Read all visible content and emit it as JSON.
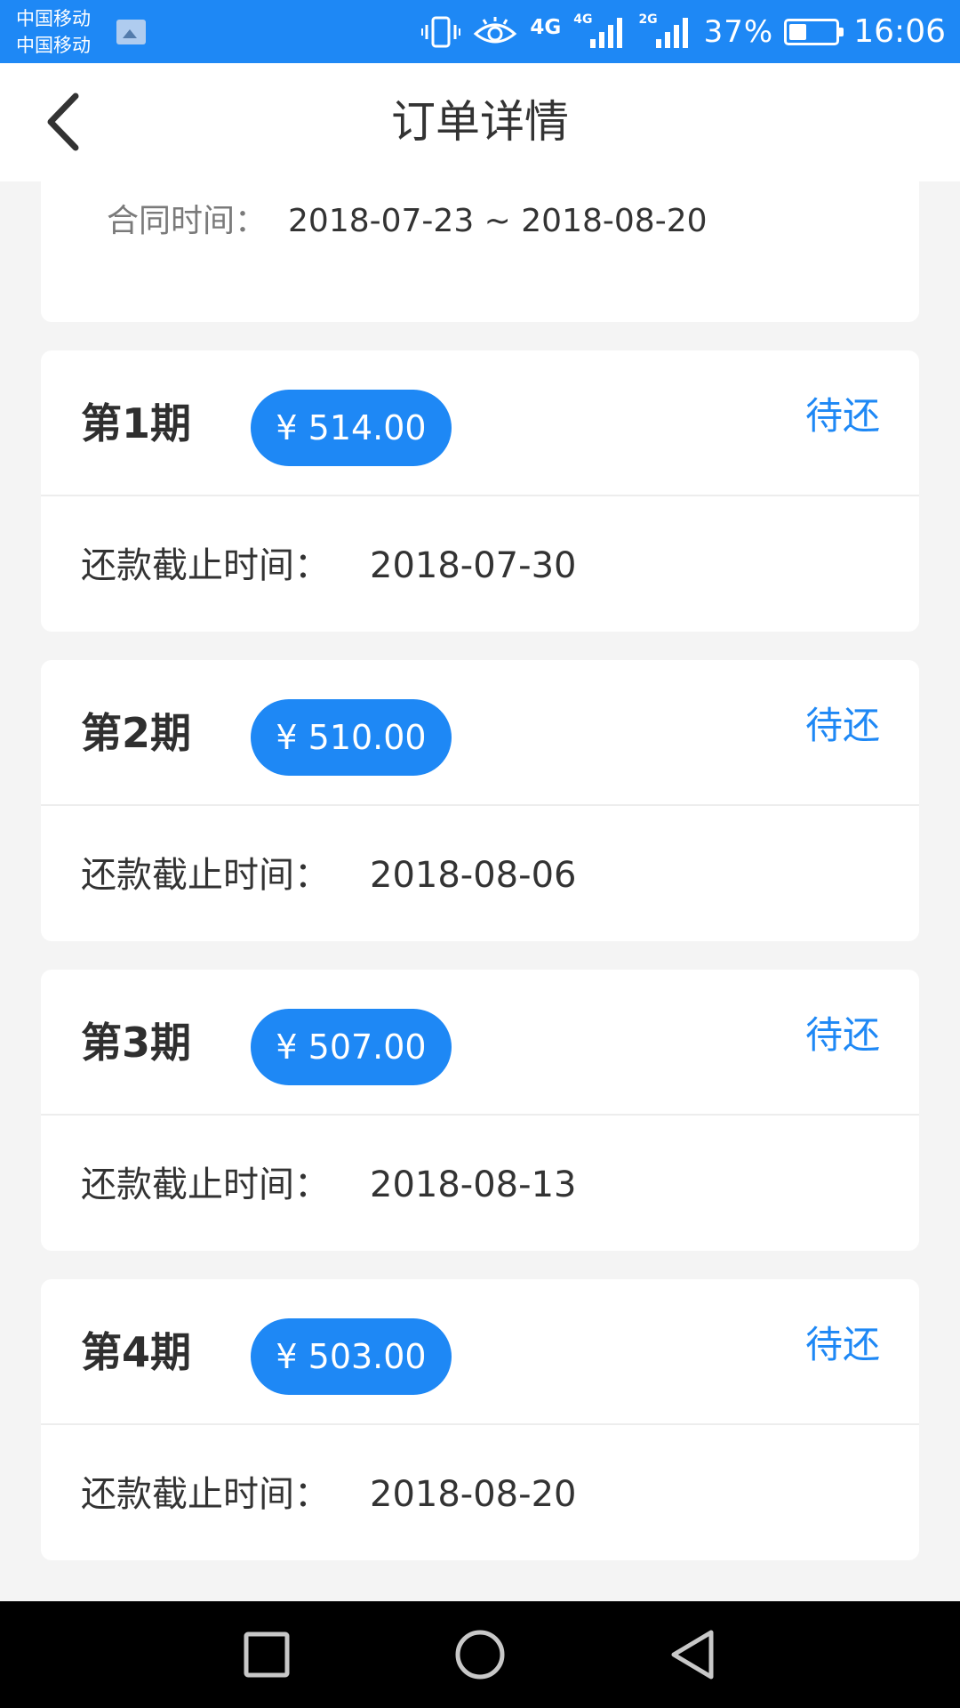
{
  "status_bar": {
    "carrier_1": "中国移动",
    "carrier_2": "中国移动",
    "network_1": "4G",
    "network_2_tag": "4G",
    "network_3_tag": "2G",
    "battery_percent": "37%",
    "battery_level": 0.37,
    "time": "16:06"
  },
  "navbar": {
    "title": "订单详情",
    "back_icon": "chevron-left-icon"
  },
  "contract": {
    "label": "合同时间：",
    "value": "2018-07-23 ~ 2018-08-20"
  },
  "installments": [
    {
      "name": "第1期",
      "amount": "¥ 514.00",
      "status": "待还",
      "due_label": "还款截止时间：",
      "due_date": "2018-07-30"
    },
    {
      "name": "第2期",
      "amount": "¥ 510.00",
      "status": "待还",
      "due_label": "还款截止时间：",
      "due_date": "2018-08-06"
    },
    {
      "name": "第3期",
      "amount": "¥ 507.00",
      "status": "待还",
      "due_label": "还款截止时间：",
      "due_date": "2018-08-13"
    },
    {
      "name": "第4期",
      "amount": "¥ 503.00",
      "status": "待还",
      "due_label": "还款截止时间：",
      "due_date": "2018-08-20"
    }
  ],
  "colors": {
    "accent": "#1e88f5",
    "background": "#f4f4f4",
    "card": "#ffffff",
    "text_primary": "#333333",
    "text_secondary": "#7a7a7a"
  }
}
